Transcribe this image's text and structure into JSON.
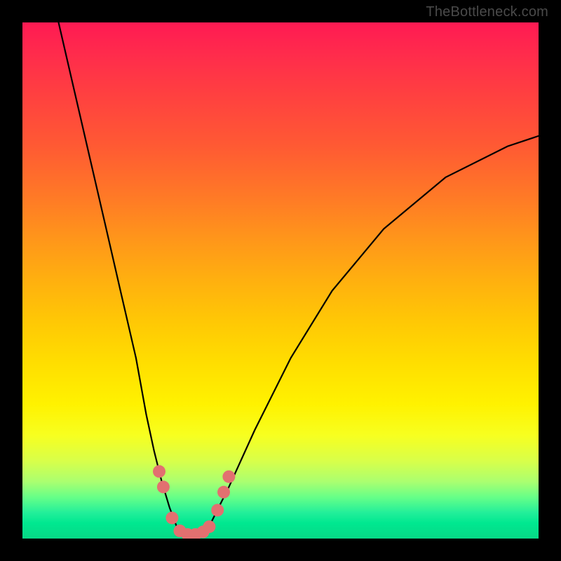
{
  "watermark": "TheBottleneck.com",
  "colors": {
    "frame": "#000000",
    "gradient_top": "#ff1a53",
    "gradient_mid": "#ffde00",
    "gradient_bottom": "#07d886",
    "curve": "#000000",
    "marker": "#e27070"
  },
  "chart_data": {
    "type": "line",
    "title": "",
    "xlabel": "",
    "ylabel": "",
    "xlim": [
      0,
      100
    ],
    "ylim": [
      0,
      100
    ],
    "grid": false,
    "legend_position": "none",
    "annotations": [
      "TheBottleneck.com"
    ],
    "series": [
      {
        "name": "left-branch",
        "x": [
          7,
          10,
          13,
          16,
          19,
          22,
          24,
          25.5,
          27,
          28.5,
          30
        ],
        "y": [
          100,
          87,
          74,
          61,
          48,
          35,
          24,
          17,
          11,
          6,
          2
        ]
      },
      {
        "name": "valley",
        "x": [
          30,
          31,
          32,
          33,
          34,
          35,
          36
        ],
        "y": [
          2,
          1,
          0.5,
          0.4,
          0.5,
          1,
          2
        ]
      },
      {
        "name": "right-branch",
        "x": [
          36,
          40,
          45,
          52,
          60,
          70,
          82,
          94,
          100
        ],
        "y": [
          2,
          10,
          21,
          35,
          48,
          60,
          70,
          76,
          78
        ]
      }
    ],
    "markers": [
      {
        "x": 26.5,
        "y": 13
      },
      {
        "x": 27.3,
        "y": 10
      },
      {
        "x": 29.0,
        "y": 4
      },
      {
        "x": 30.5,
        "y": 1.5
      },
      {
        "x": 32.0,
        "y": 0.8
      },
      {
        "x": 33.5,
        "y": 0.8
      },
      {
        "x": 35.0,
        "y": 1.3
      },
      {
        "x": 36.2,
        "y": 2.3
      },
      {
        "x": 37.8,
        "y": 5.5
      },
      {
        "x": 39.0,
        "y": 9
      },
      {
        "x": 40.0,
        "y": 12
      }
    ],
    "marker_radius": 9
  }
}
